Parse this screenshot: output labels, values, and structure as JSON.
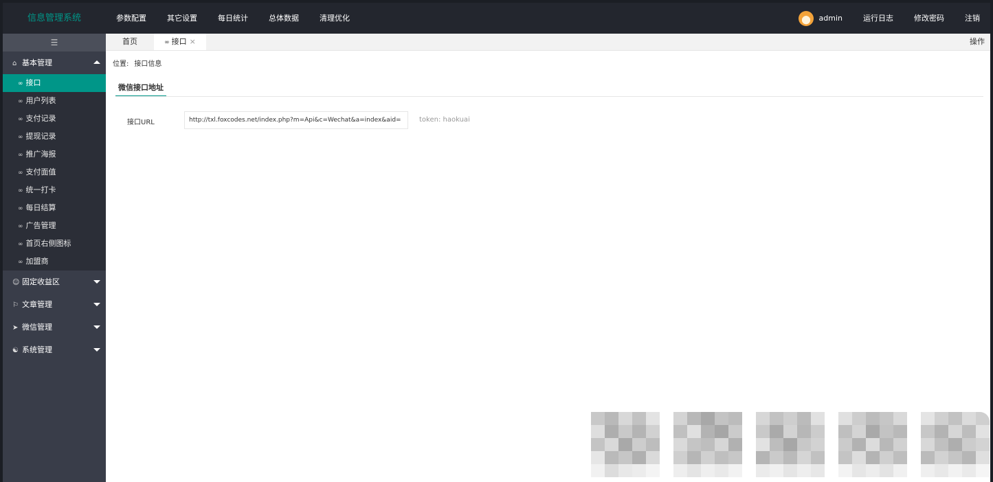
{
  "app": {
    "logo_text": "信息管理系统",
    "accent_color": "#009688"
  },
  "topnav": {
    "items": [
      "参数配置",
      "其它设置",
      "每日统计",
      "总体数据",
      "清理优化"
    ]
  },
  "user": {
    "name": "admin",
    "links": [
      "运行日志",
      "修改密码",
      "注销"
    ]
  },
  "sidebar": {
    "toggle_icon": "menu-toggle-icon",
    "groups": [
      {
        "label": "基本管理",
        "icon": "home-icon",
        "expanded": true,
        "items": [
          "接口",
          "用户列表",
          "支付记录",
          "提现记录",
          "推广海报",
          "支付面值",
          "统一打卡",
          "每日结算",
          "广告管理",
          "首页右侧图标",
          "加盟商"
        ],
        "active_index": 0
      },
      {
        "label": "固定收益区",
        "icon": "user-group-icon",
        "expanded": false
      },
      {
        "label": "文章管理",
        "icon": "flag-icon",
        "expanded": false
      },
      {
        "label": "微信管理",
        "icon": "send-icon",
        "expanded": false
      },
      {
        "label": "系统管理",
        "icon": "user-icon",
        "expanded": false
      }
    ]
  },
  "tabs": {
    "home": "首页",
    "active": "接口",
    "close": "×",
    "ops": "操作"
  },
  "breadcrumb": {
    "label": "位置:",
    "path": "接口信息"
  },
  "section": {
    "title": "微信接口地址"
  },
  "form": {
    "url_label": "接口URL",
    "url_value": "http://txl.foxcodes.net/index.php?m=Api&c=Wechat&a=index&aid=",
    "token_note": "token: haokuai"
  }
}
